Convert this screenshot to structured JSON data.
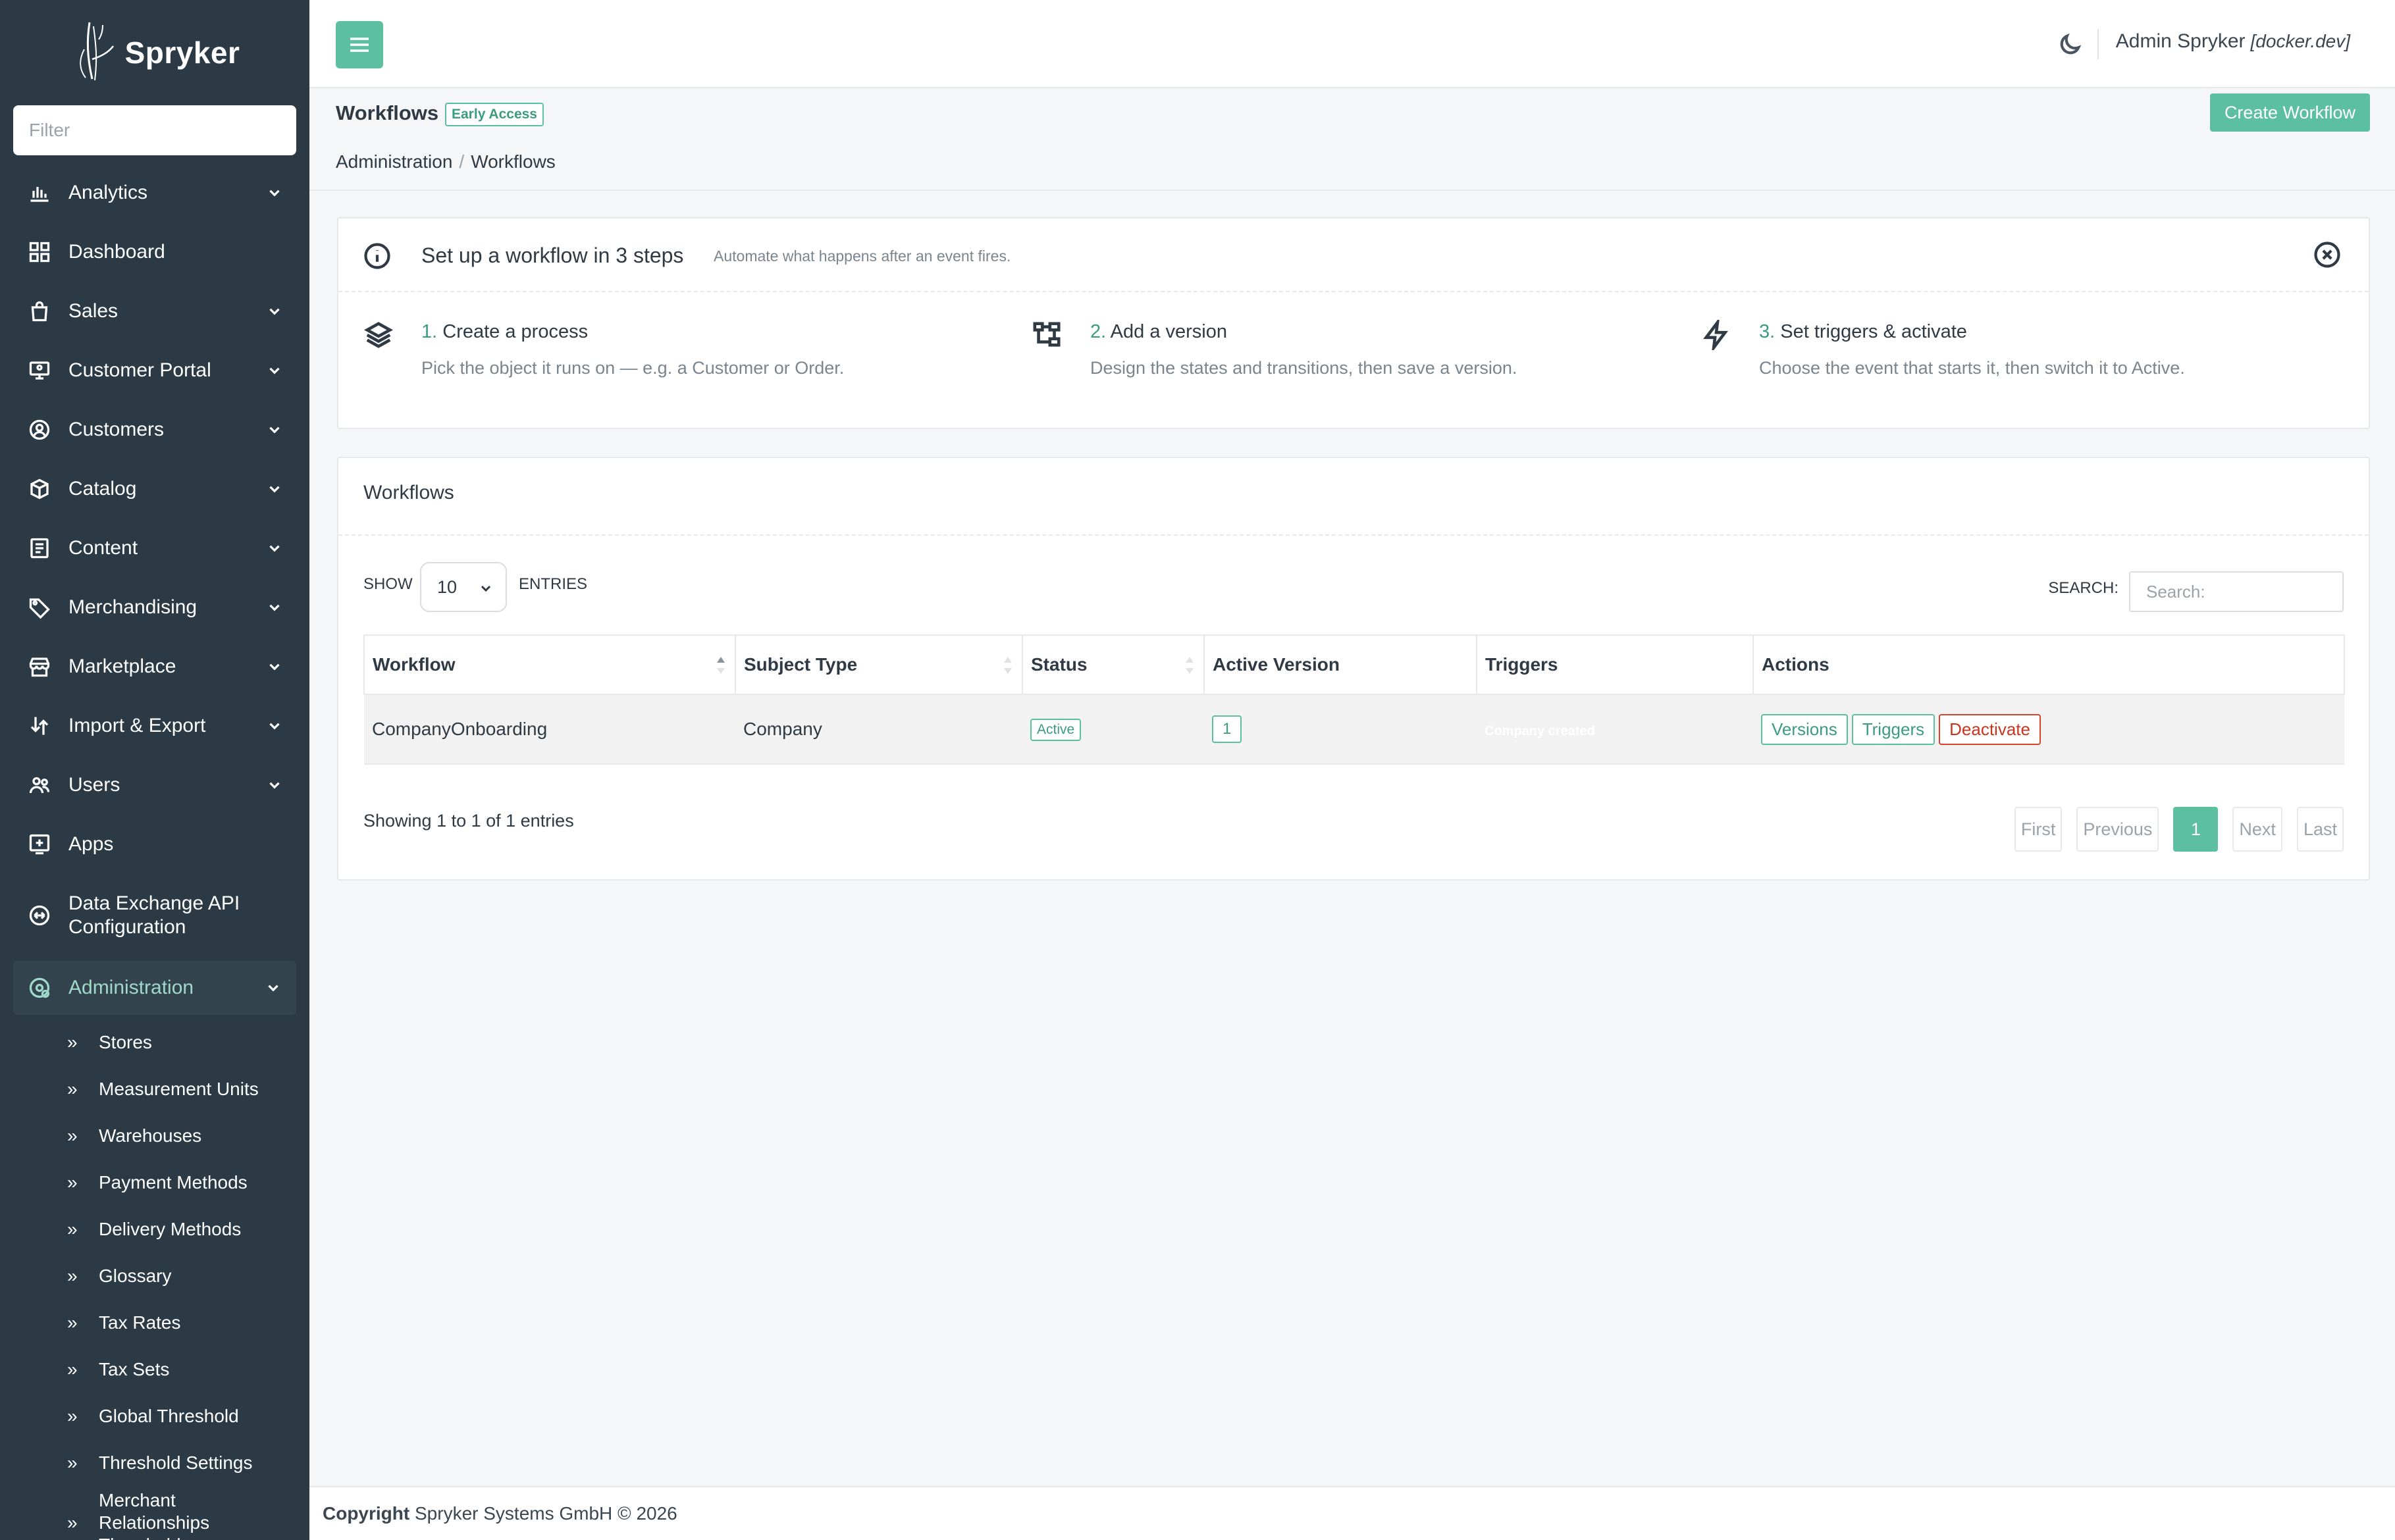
{
  "app": {
    "brand": "Spryker"
  },
  "sidebar": {
    "filter_placeholder": "Filter",
    "items": [
      {
        "label": "Analytics",
        "icon": "bar-chart-icon"
      },
      {
        "label": "Dashboard",
        "icon": "grid-icon"
      },
      {
        "label": "Sales",
        "icon": "shopping-bag-icon"
      },
      {
        "label": "Customer Portal",
        "icon": "monitor-user-icon"
      },
      {
        "label": "Customers",
        "icon": "user-circle-icon"
      },
      {
        "label": "Catalog",
        "icon": "box-icon"
      },
      {
        "label": "Content",
        "icon": "document-icon"
      },
      {
        "label": "Merchandising",
        "icon": "tag-icon"
      },
      {
        "label": "Marketplace",
        "icon": "store-icon"
      },
      {
        "label": "Import & Export",
        "icon": "import-export-icon"
      },
      {
        "label": "Users",
        "icon": "users-icon"
      },
      {
        "label": "Apps",
        "icon": "plus-square-icon"
      },
      {
        "label": "Data Exchange API Configuration",
        "icon": "exchange-icon"
      },
      {
        "label": "Administration",
        "icon": "admin-gear-icon"
      }
    ],
    "admin_sub": [
      "Stores",
      "Measurement Units",
      "Warehouses",
      "Payment Methods",
      "Delivery Methods",
      "Glossary",
      "Tax Rates",
      "Tax Sets",
      "Global Threshold",
      "Threshold Settings",
      "Merchant Relationships Threshold"
    ]
  },
  "topbar": {
    "user_name": "Admin Spryker",
    "env": "[docker.dev]"
  },
  "page": {
    "title": "Workflows",
    "badge": "Early Access",
    "create_label": "Create Workflow",
    "breadcrumb": [
      "Administration",
      "Workflows"
    ]
  },
  "info": {
    "title": "Set up a workflow in 3 steps",
    "subtitle": "Automate what happens after an event fires.",
    "steps": [
      {
        "num": "1.",
        "title": "Create a process",
        "desc": "Pick the object it runs on — e.g. a Customer or Order."
      },
      {
        "num": "2.",
        "title": "Add a version",
        "desc": "Design the states and transitions, then save a version."
      },
      {
        "num": "3.",
        "title": "Set triggers & activate",
        "desc": "Choose the event that starts it, then switch it to Active."
      }
    ]
  },
  "table": {
    "panel_title": "Workflows",
    "show_label": "SHOW",
    "page_size": "10",
    "entries_label": "ENTRIES",
    "search_label": "SEARCH:",
    "search_placeholder": "Search:",
    "columns": [
      "Workflow",
      "Subject Type",
      "Status",
      "Active Version",
      "Triggers",
      "Actions"
    ],
    "rows": [
      {
        "workflow": "CompanyOnboarding",
        "subject_type": "Company",
        "status": "Active",
        "active_version": "1",
        "triggers": "Company created",
        "actions": [
          "Versions",
          "Triggers",
          "Deactivate"
        ]
      }
    ],
    "showing": "Showing 1 to 1 of 1 entries",
    "pager": {
      "first": "First",
      "previous": "Previous",
      "current": "1",
      "next": "Next",
      "last": "Last"
    }
  },
  "footer": {
    "copyright_label": "Copyright",
    "text": "Spryker Systems GmbH © 2026"
  },
  "colors": {
    "accent": "#5bbfa0",
    "sidebar": "#2b3a45",
    "danger": "#c7371f"
  }
}
